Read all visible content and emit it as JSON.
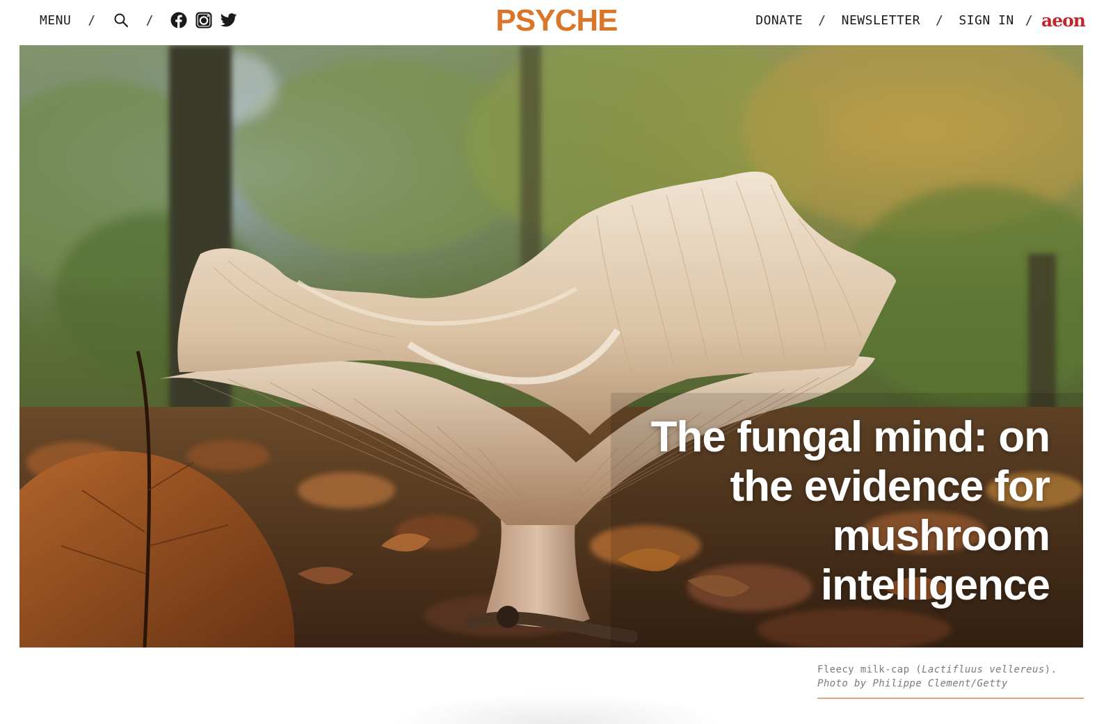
{
  "header": {
    "menu_label": "MENU",
    "separator": "/",
    "logo_text": "PSYCHE",
    "donate_label": "DONATE",
    "newsletter_label": "NEWSLETTER",
    "sign_in_label": "SIGN IN",
    "aeon_logo_text": "aeon",
    "icons": [
      "search-icon",
      "facebook-icon",
      "instagram-icon",
      "twitter-icon"
    ],
    "brand_color": "#d9762a",
    "aeon_color": "#c0272d"
  },
  "hero": {
    "title": "The fungal mind: on the evidence for mushroom intelligence"
  },
  "caption": {
    "common_name": "Fleecy milk-cap (",
    "species": "Lactifluus vellereus",
    "mid": "). ",
    "credit": "Photo by Philippe Clement/Getty",
    "rule_color": "#e8a07c"
  }
}
